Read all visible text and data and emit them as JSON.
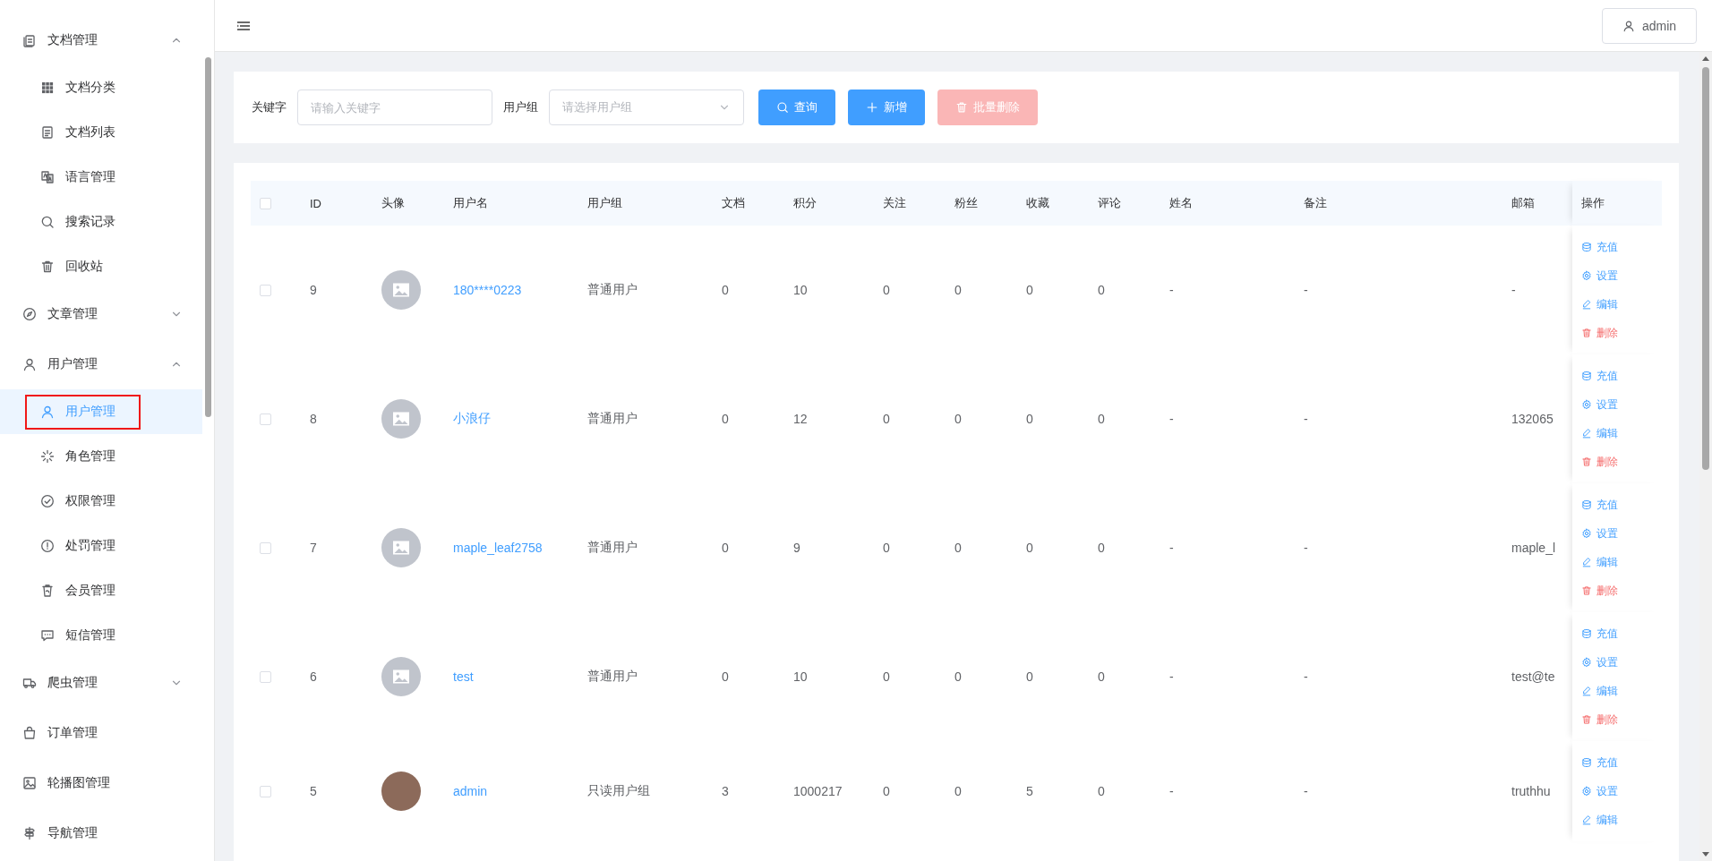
{
  "sidebar": {
    "items": [
      {
        "label": "文档管理",
        "expanded": true,
        "children": [
          {
            "label": "文档分类",
            "selected": false,
            "annotated": false
          },
          {
            "label": "文档列表",
            "selected": false,
            "annotated": false
          },
          {
            "label": "语言管理",
            "selected": false,
            "annotated": false
          },
          {
            "label": "搜索记录",
            "selected": false,
            "annotated": false
          },
          {
            "label": "回收站",
            "selected": false,
            "annotated": false
          }
        ]
      },
      {
        "label": "文章管理",
        "expanded": false
      },
      {
        "label": "用户管理",
        "expanded": true,
        "children": [
          {
            "label": "用户管理",
            "selected": true,
            "annotated": true
          },
          {
            "label": "角色管理",
            "selected": false,
            "annotated": false
          },
          {
            "label": "权限管理",
            "selected": false,
            "annotated": false
          },
          {
            "label": "处罚管理",
            "selected": false,
            "annotated": false
          },
          {
            "label": "会员管理",
            "selected": false,
            "annotated": false
          },
          {
            "label": "短信管理",
            "selected": false,
            "annotated": false
          }
        ]
      },
      {
        "label": "爬虫管理",
        "expanded": false
      },
      {
        "label": "订单管理"
      },
      {
        "label": "轮播图管理"
      },
      {
        "label": "导航管理"
      }
    ]
  },
  "header": {
    "user_button": "admin"
  },
  "filters": {
    "keyword": {
      "label": "关键字",
      "placeholder": "请输入关键字"
    },
    "group": {
      "label": "用户组",
      "placeholder": "请选择用户组"
    },
    "buttons": [
      {
        "kind": "search",
        "label": "查询",
        "disabled": false
      },
      {
        "kind": "add",
        "label": "新增",
        "disabled": false
      },
      {
        "kind": "delete",
        "label": "批量删除",
        "disabled": true
      }
    ]
  },
  "table": {
    "select_all_checked": false,
    "columns": [
      "ID",
      "头像",
      "用户名",
      "用户组",
      "文档",
      "积分",
      "关注",
      "粉丝",
      "收藏",
      "评论",
      "姓名",
      "备注",
      "邮箱",
      "操作"
    ],
    "rows": [
      {
        "checked": false,
        "id": "9",
        "avatar": {
          "kind": "placeholder"
        },
        "username": "180****0223",
        "group": "普通用户",
        "docs": "0",
        "points": "10",
        "follows": "0",
        "fans": "0",
        "favorites": "0",
        "comments": "0",
        "name": "-",
        "note": "-",
        "email": "-",
        "actions": [
          {
            "kind": "recharge",
            "label": "充值"
          },
          {
            "kind": "settings",
            "label": "设置"
          },
          {
            "kind": "edit",
            "label": "编辑"
          },
          {
            "kind": "delete",
            "label": "删除"
          }
        ]
      },
      {
        "checked": false,
        "id": "8",
        "avatar": {
          "kind": "placeholder"
        },
        "username": "小浪仔",
        "group": "普通用户",
        "docs": "0",
        "points": "12",
        "follows": "0",
        "fans": "0",
        "favorites": "0",
        "comments": "0",
        "name": "-",
        "note": "-",
        "email": "132065",
        "actions": [
          {
            "kind": "recharge",
            "label": "充值"
          },
          {
            "kind": "settings",
            "label": "设置"
          },
          {
            "kind": "edit",
            "label": "编辑"
          },
          {
            "kind": "delete",
            "label": "删除"
          }
        ]
      },
      {
        "checked": false,
        "id": "7",
        "avatar": {
          "kind": "placeholder"
        },
        "username": "maple_leaf2758",
        "group": "普通用户",
        "docs": "0",
        "points": "9",
        "follows": "0",
        "fans": "0",
        "favorites": "0",
        "comments": "0",
        "name": "-",
        "note": "-",
        "email": "maple_l",
        "actions": [
          {
            "kind": "recharge",
            "label": "充值"
          },
          {
            "kind": "settings",
            "label": "设置"
          },
          {
            "kind": "edit",
            "label": "编辑"
          },
          {
            "kind": "delete",
            "label": "删除"
          }
        ]
      },
      {
        "checked": false,
        "id": "6",
        "avatar": {
          "kind": "placeholder"
        },
        "username": "test",
        "group": "普通用户",
        "docs": "0",
        "points": "10",
        "follows": "0",
        "fans": "0",
        "favorites": "0",
        "comments": "0",
        "name": "-",
        "note": "-",
        "email": "test@te",
        "actions": [
          {
            "kind": "recharge",
            "label": "充值"
          },
          {
            "kind": "settings",
            "label": "设置"
          },
          {
            "kind": "edit",
            "label": "编辑"
          },
          {
            "kind": "delete",
            "label": "删除"
          }
        ]
      },
      {
        "checked": false,
        "id": "5",
        "avatar": {
          "kind": "photo"
        },
        "username": "admin",
        "group": "只读用户组",
        "docs": "3",
        "points": "1000217",
        "follows": "0",
        "fans": "0",
        "favorites": "5",
        "comments": "0",
        "name": "-",
        "note": "-",
        "email": "truthhu",
        "actions": [
          {
            "kind": "recharge",
            "label": "充值"
          },
          {
            "kind": "settings",
            "label": "设置"
          },
          {
            "kind": "edit",
            "label": "编辑"
          }
        ]
      }
    ]
  }
}
